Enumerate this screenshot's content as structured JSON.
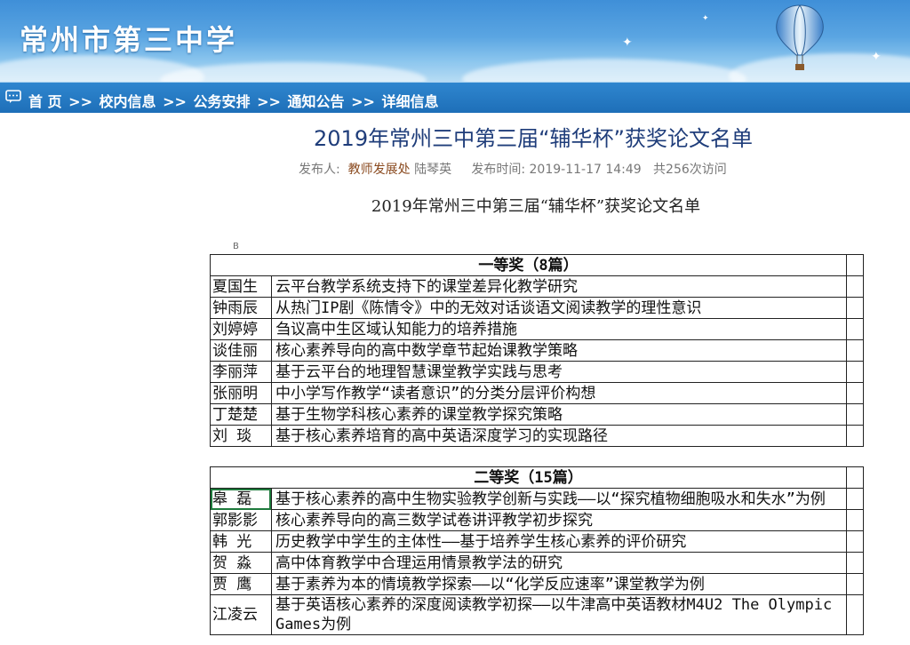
{
  "site": {
    "title": "常州市第三中学"
  },
  "breadcrumb": [
    "首 页",
    ">>",
    "校内信息",
    ">>",
    "公务安排",
    ">>",
    "通知公告",
    ">>",
    "详细信息"
  ],
  "article": {
    "title": "2019年常州三中第三届“辅华杯”获奖论文名单",
    "meta": {
      "publisher_label": "发布人:",
      "publisher_dept": "教师发展处",
      "publisher_name": "陆琴英",
      "time_label": "发布时间:",
      "time_value": "2019-11-17 14:49",
      "visits": "共256次访问"
    },
    "content_title": "2019年常州三中第三届“辅华杯”获奖论文名单"
  },
  "sheet": {
    "column_letter": "B",
    "sections": [
      {
        "heading": "一等奖（8篇）",
        "rows": [
          {
            "name": "夏国生",
            "title": "云平台教学系统支持下的课堂差异化教学研究"
          },
          {
            "name": "钟雨辰",
            "title": "从热门IP剧《陈情令》中的无效对话谈语文阅读教学的理性意识"
          },
          {
            "name": "刘婷婷",
            "title": "刍议高中生区域认知能力的培养措施"
          },
          {
            "name": "谈佳丽",
            "title": "核心素养导向的高中数学章节起始课教学策略"
          },
          {
            "name": "李丽萍",
            "title": "基于云平台的地理智慧课堂教学实践与思考"
          },
          {
            "name": "张丽明",
            "title": "中小学写作教学“读者意识”的分类分层评价构想"
          },
          {
            "name": "丁楚楚",
            "title": "基于生物学科核心素养的课堂教学探究策略"
          },
          {
            "name": "刘  琰",
            "title": "基于核心素养培育的高中英语深度学习的实现路径"
          }
        ]
      },
      {
        "heading": "二等奖（15篇）",
        "rows": [
          {
            "name": "皋  磊",
            "title": "基于核心素养的高中生物实验教学创新与实践——以“探究植物细胞吸水和失水”为例"
          },
          {
            "name": "郭影影",
            "title": "核心素养导向的高三数学试卷讲评教学初步探究"
          },
          {
            "name": "韩  光",
            "title": "历史教学中学生的主体性——基于培养学生核心素养的评价研究"
          },
          {
            "name": "贺  淼",
            "title": "高中体育教学中合理运用情景教学法的研究"
          },
          {
            "name": "贾  鹰",
            "title": "基于素养为本的情境教学探索——以“化学反应速率”课堂教学为例"
          },
          {
            "name": "江凌云",
            "title": "基于英语核心素养的深度阅读教学初探——以牛津高中英语教材M4U2 The Olympic Games为例"
          }
        ]
      }
    ]
  },
  "colors": {
    "banner": "#4a9ae0",
    "crumbbar": "#2379c2",
    "title": "#1f3d7a",
    "dept": "#8a4a1f"
  }
}
